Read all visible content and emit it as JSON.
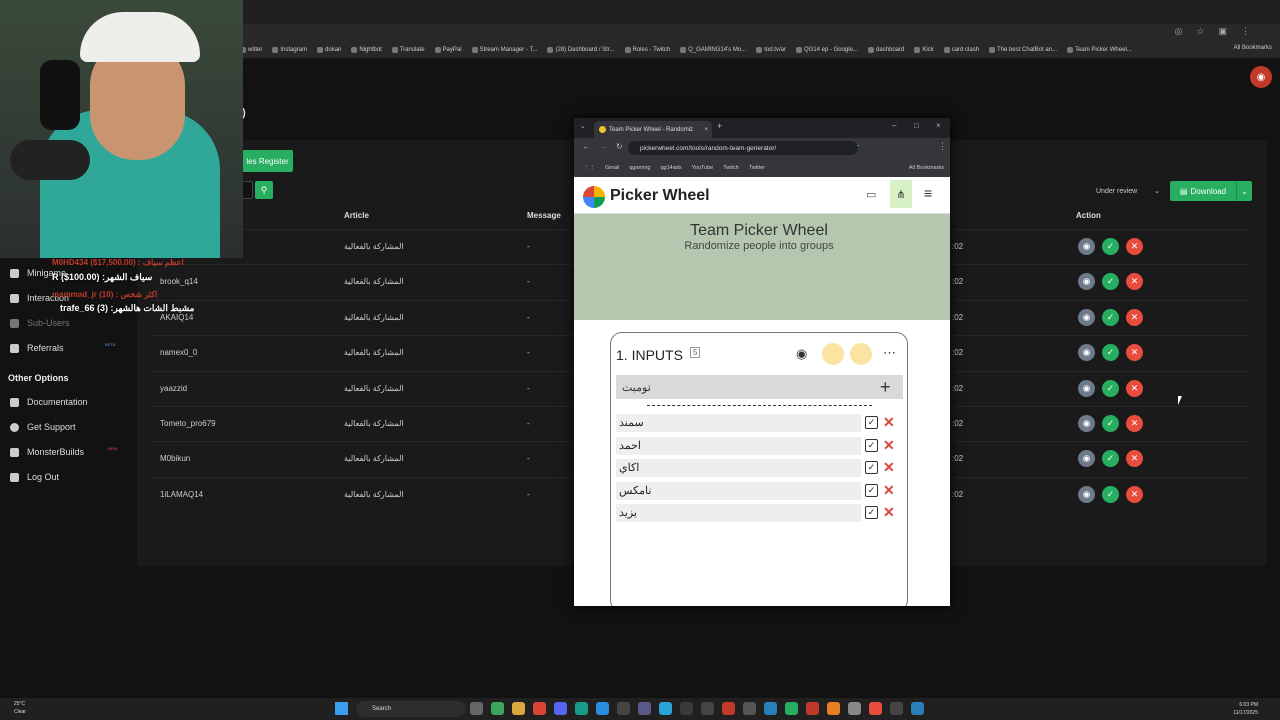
{
  "bookmarks": [
    "witter",
    "Instagram",
    "dokan",
    "Nightbot",
    "Translate",
    "PayPal",
    "Stream Manager - T...",
    "(28) Dashboard / Str...",
    "Roles - Twitch",
    "Q_GAMING14's Mo...",
    "tod.tv/ar",
    "QG14 ep - Google...",
    "dashboard",
    "Kick",
    "card clash",
    "The best ChatBot an...",
    "Team Picker Wheel..."
  ],
  "all_bookmarks": "All Bookmarks",
  "page": {
    "heading": "k)",
    "register_button": "les Register",
    "status_select": "Under review",
    "download_button": "Download",
    "columns": {
      "article": "Article",
      "message": "Message",
      "action": "Action"
    },
    "rows": [
      {
        "user": "",
        "article": "المشاركة بالفعالية",
        "message": "-",
        "date": ":02"
      },
      {
        "user": "brook_q14",
        "article": "المشاركة بالفعالية",
        "message": "-",
        "date": ":02"
      },
      {
        "user": "AKAIQ14",
        "article": "المشاركة بالفعالية",
        "message": "-",
        "date": ":02"
      },
      {
        "user": "namex0_0",
        "article": "المشاركة بالفعالية",
        "message": "-",
        "date": ":02"
      },
      {
        "user": "yaazzid",
        "article": "المشاركة بالفعالية",
        "message": "-",
        "date": ":02"
      },
      {
        "user": "Tometo_pro679",
        "article": "المشاركة بالفعالية",
        "message": "-",
        "date": ":02"
      },
      {
        "user": "M0bikun",
        "article": "المشاركة بالفعالية",
        "message": "-",
        "date": ":02"
      },
      {
        "user": "1iLAMAQ14",
        "article": "المشاركة بالفعالية",
        "message": "-",
        "date": ":02"
      }
    ]
  },
  "sidebar": {
    "items": [
      {
        "label": "Minigame"
      },
      {
        "label": "Interaction"
      },
      {
        "label": "Sub-Users"
      },
      {
        "label": "Referrals",
        "badge": "BETA"
      }
    ],
    "other_options": "Other Options",
    "other_items": [
      {
        "label": "Documentation"
      },
      {
        "label": "Get Support"
      },
      {
        "label": "MonsterBuilds",
        "badge": "NEW"
      },
      {
        "label": "Log Out"
      }
    ]
  },
  "overlay": {
    "line1": "سياف الشهر: R ($100.00)",
    "line2": "مشبط الشات هالشهر: trafe_66 (3)",
    "red1": "M0HD434 ($17,500.00) : اعظم سياف",
    "red2": "mammad_jr (10) : اكثر شخص"
  },
  "popup": {
    "tab_title": "Team Picker Wheel - Randomiz",
    "url": "pickerwheel.com/tools/random-team-generator/",
    "bookmarks": [
      "Gmail",
      "qgaming",
      "qg14ads",
      "YouTube",
      "Twitch",
      "Twitter"
    ],
    "all_bookmarks": "All Bookmarks",
    "brand": "Picker Wheel",
    "hero_title": "Team Picker Wheel",
    "hero_subtitle": "Randomize people into groups",
    "inputs_title": "1. INPUTS",
    "inputs_count": "5",
    "input_value": "تومبت",
    "entries": [
      "سمند",
      "احمد",
      "اكاي",
      "نامكس",
      "يزيد"
    ]
  },
  "taskbar": {
    "weather_temp": "25°C",
    "weather_desc": "Clear",
    "search": "Search",
    "time": "6:03 PM",
    "date": "11/17/2025"
  }
}
